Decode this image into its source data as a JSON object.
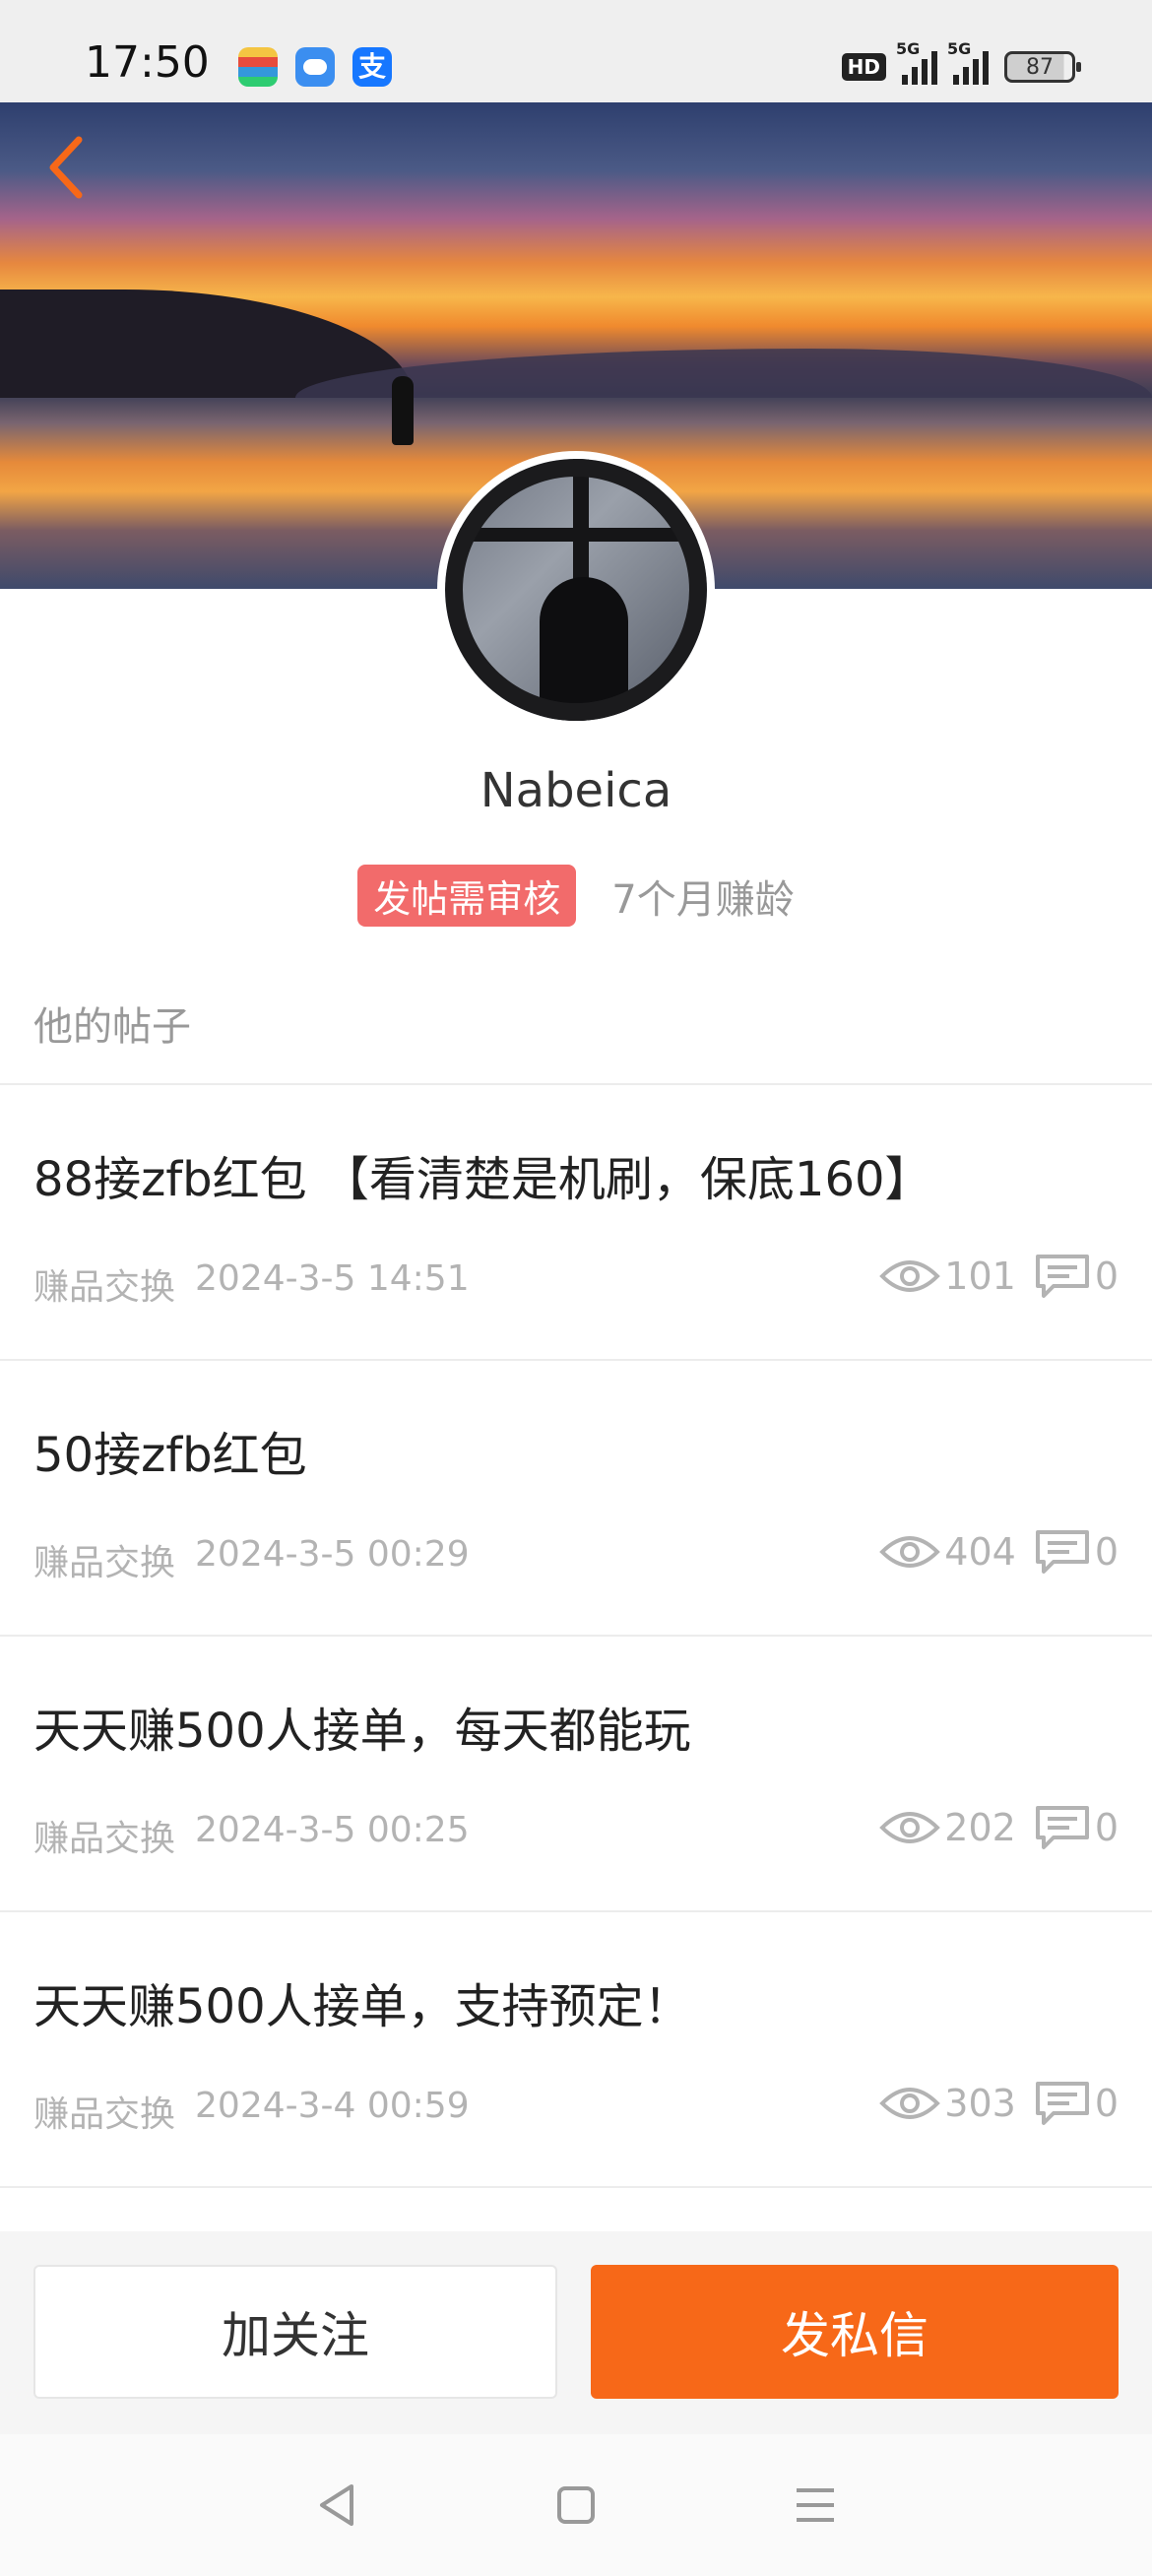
{
  "status_bar": {
    "time": "17:50",
    "apps": [
      "wallet-app-icon",
      "weather-app-icon",
      "alipay-app-icon"
    ],
    "alipay_glyph": "支",
    "hd_label": "HD",
    "signal_label_1": "5G",
    "signal_label_2": "5G",
    "battery": "87"
  },
  "profile": {
    "username": "Nabeica",
    "review_badge": "发帖需审核",
    "earn_age": "7个月赚龄"
  },
  "section": {
    "title": "他的帖子"
  },
  "posts": [
    {
      "title": "88接zfb红包 【看清楚是机刷，保底160】",
      "category": "赚品交换",
      "time": "2024-3-5 14:51",
      "views": "101",
      "comments": "0"
    },
    {
      "title": "50接zfb红包",
      "category": "赚品交换",
      "time": "2024-3-5 00:29",
      "views": "404",
      "comments": "0"
    },
    {
      "title": "天天赚500人接单，每天都能玩",
      "category": "赚品交换",
      "time": "2024-3-5 00:25",
      "views": "202",
      "comments": "0"
    },
    {
      "title": "天天赚500人接单，支持预定！",
      "category": "赚品交换",
      "time": "2024-3-4 00:59",
      "views": "303",
      "comments": "0"
    }
  ],
  "actions": {
    "follow_label": "加关注",
    "message_label": "发私信"
  },
  "colors": {
    "accent": "#f76818",
    "badge": "#f26b6b",
    "muted": "#b3b3b3"
  }
}
